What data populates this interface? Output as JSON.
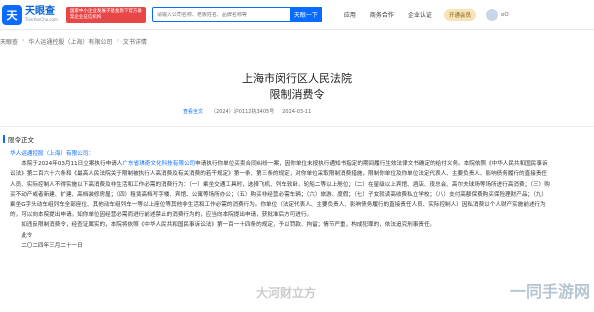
{
  "header": {
    "logo_mark": "天",
    "logo_cn": "天眼查",
    "logo_en": "TianYanCha.com",
    "badge": "国家中小企业发展子基金旗下官方备案企业征信机构",
    "search_placeholder": "请输入公司名称、老板姓名、品牌名称等",
    "search_button": "天眼一下",
    "nav": [
      "应用",
      "商务合作",
      "企业认证"
    ],
    "vip": "开通会员",
    "user_name": "oO"
  },
  "breadcrumb": [
    "天眼查",
    "华人运通控股（上海）有限公司",
    "文书详情"
  ],
  "document": {
    "court": "上海市闵行区人民法院",
    "title": "限制消费令",
    "meta_link": "查看全文",
    "case_no": "（2024）沪0112执3405号",
    "date": "2024-03-11",
    "section": "限令正文",
    "company": "华人运通控股（上海）有限公司：",
    "p1_a": "本院于2024年03月11日立案执行申请人",
    "p1_link": "广东省琪奇文化科技有限公司",
    "p1_b": "申请执行你单位买卖合同纠纷一案，因你单位未按执行通知书指定的期间履行生效法律文书确定的给付义务。本院依照《中华人民共和国民事诉讼法》第二百六十六条和《最高人民法院关于限制被执行人高消费及有关消费的若干规定》第一条、第三条的规定，对你单位采取限制消费措施，限制你单位及你单位法定代表人、主要负责人、影响债务履行的直接责任人员、实际控制人不得实施以下高消费及非生活和工作必需的消费行为：（一）乘坐交通工具时，选择飞机、列车软卧、轮船二等以上舱位；（二）在星级以上宾馆、酒店、夜总会、高尔夫球场等场所进行高消费；（三）购买不动产或者新建、扩建、高档装修房屋；（四）租赁高档写字楼、宾馆、公寓等场所办公；（五）购买非经营必需车辆；（六）旅游、度假；（七）子女就读高收费私立学校；（八）支付高额保费购买保险理财产品；（九）乘坐G字头动车组列车全部座位、其他动车组列车一等以上座位等其他非生活和工作必需的消费行为。你单位（法定代表人、主要负责人、影响债务履行的直接责任人员、实际控制人）因私消费以个人财产实施前述行为的，可以向本院提出申请。如你单位因经营必需而进行前述禁止的消费行为的，应当向本院提出申请，获批准后方可进行。",
    "p2": "如违反限制消费令，经查证属实的，本院将依照《中华人民共和国民事诉讼法》第一百一十四条的规定，予以罚款、拘留；情节严重，构成犯罪的，依法追究刑事责任。",
    "closing": "此令",
    "sign_date": "二〇二四年三月二十一日"
  },
  "watermarks": {
    "center": "大河财立方",
    "corner": "一同手游网"
  }
}
